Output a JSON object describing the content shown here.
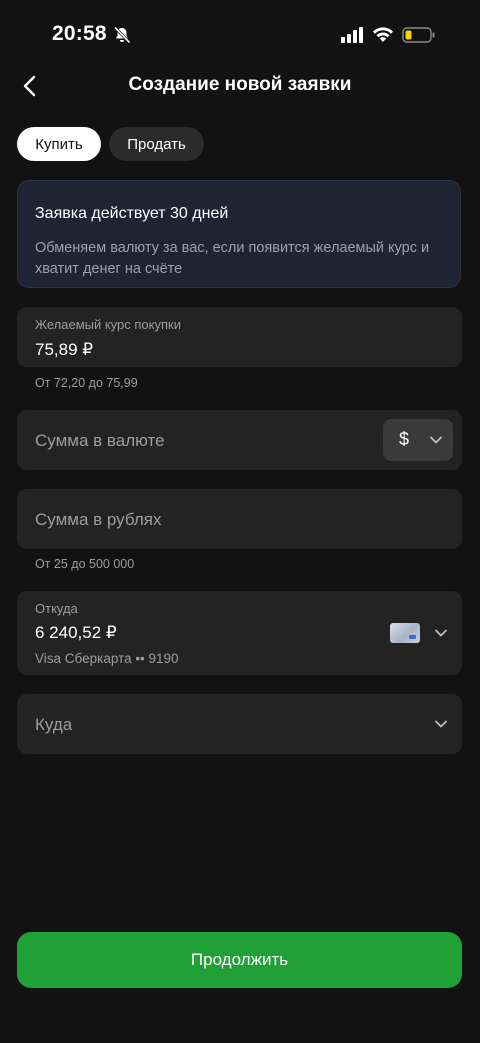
{
  "status_bar": {
    "time": "20:58"
  },
  "header": {
    "title": "Создание новой заявки"
  },
  "tabs": {
    "buy": "Купить",
    "sell": "Продать"
  },
  "info": {
    "title": "Заявка действует 30 дней",
    "description": "Обменяем валюту за вас, если появится желаемый курс и хватит денег на счёте"
  },
  "rate": {
    "label": "Желаемый курс покупки",
    "value": "75,89 ₽",
    "hint": "От 72,20 до 75,99"
  },
  "currency_amount": {
    "placeholder": "Сумма в валюте",
    "currency": "$"
  },
  "rub_amount": {
    "placeholder": "Сумма в рублях",
    "hint": "От 25 до 500 000"
  },
  "from": {
    "label": "Откуда",
    "amount": "6 240,52 ₽",
    "card": "Visa Сберкарта •• 9190"
  },
  "to": {
    "placeholder": "Куда"
  },
  "cta": {
    "label": "Продолжить"
  },
  "colors": {
    "accent": "#21a038",
    "background": "#121212",
    "field": "#232323",
    "info_bg": "#1f2433"
  }
}
